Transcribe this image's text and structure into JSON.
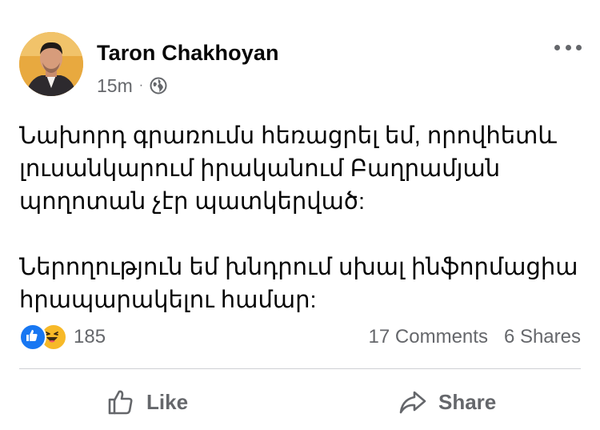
{
  "post": {
    "author": "Taron Chakhoyan",
    "time": "15m",
    "separator": "·",
    "privacy_icon": "globe-icon",
    "menu_icon": "more-options-icon",
    "text": {
      "paragraph1": [
        "Նախորդ գրառումս հեռացրել եմ, որովհետև",
        "լուսանկարում իրականում Բաղրամյան",
        "պողոտան չէր պատկերված:"
      ],
      "paragraph2": [
        "Ներողություն եմ խնդրում սխալ ինֆորմացիա",
        "հրապարակելու համար:"
      ]
    }
  },
  "engagement": {
    "reaction_icons": [
      "like-reaction-icon",
      "haha-reaction-icon"
    ],
    "reaction_count": "185",
    "comments": "17 Comments",
    "shares": "6 Shares"
  },
  "actions": {
    "like_label": "Like",
    "share_label": "Share"
  },
  "colors": {
    "text_primary": "#050505",
    "text_secondary": "#65676b",
    "like_blue": "#1877f2",
    "haha_yellow": "#f7b928",
    "divider": "#ced0d4"
  }
}
